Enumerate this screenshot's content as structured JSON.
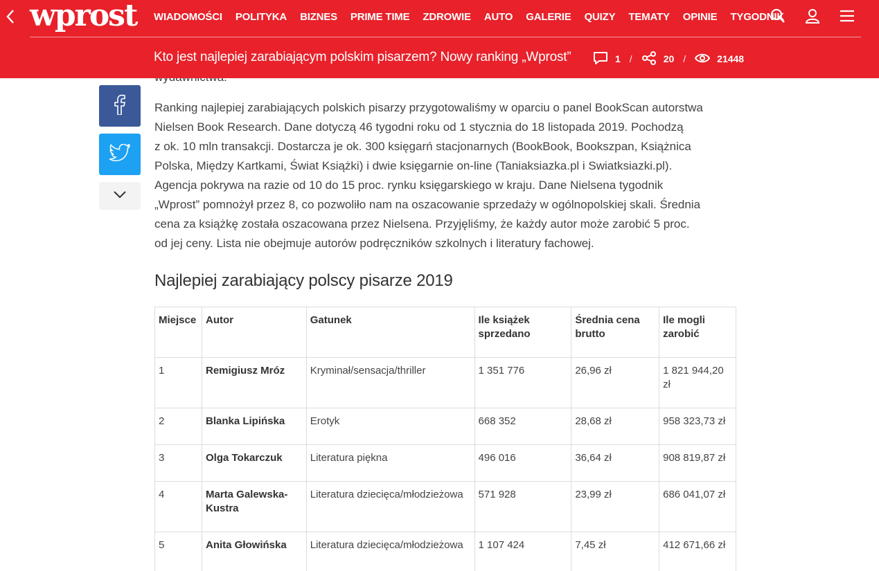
{
  "header": {
    "logo": "wprost",
    "nav": [
      "WIADOMOŚCI",
      "POLITYKA",
      "BIZNES",
      "PRIME TIME",
      "ZDROWIE",
      "AUTO",
      "GALERIE",
      "QUIZY",
      "TEMATY",
      "OPINIE",
      "TYGODNIK"
    ],
    "article_title": "Kto jest najlepiej zarabiającym polskim pisarzem? Nowy ranking „Wprost”",
    "comments": "1",
    "shares": "20",
    "views": "21448",
    "separator": "/"
  },
  "article": {
    "cut_text": "wydawnictwa.",
    "paragraph_lines": [
      "Ranking najlepiej zarabiających polskich pisarzy przygotowaliśmy w oparciu o panel BookScan autorstwa",
      "Nielsen Book Research. Dane dotyczą 46 tygodni roku od 1 stycznia do 18 listopada 2019. Pochodzą",
      "z ok. 10 mln transakcji. Dostarcza je ok. 300 księgarń stacjonarnych (BookBook, Bookszpan, Książnica",
      "Polska, Między Kartkami, Świat Książki) i dwie księgarnie on-line (Taniaksiazka.pl i Swiatksiazki.pl).",
      "Agencja pokrywa na razie od 10 do 15 proc. rynku księgarskiego w kraju. Dane Nielsena tygodnik",
      "„Wprost” pomnożył przez 8, co pozwoliło nam na oszacowanie sprzedaży w ogólnopolskiej skali. Średnia",
      "cena za książkę została oszacowana przez Nielsena. Przyjęliśmy, że każdy autor może zarobić 5 proc.",
      "od jej ceny. Lista nie obejmuje autorów podręczników szkolnych i literatury fachowej."
    ],
    "section_title": "Najlepiej zarabiający polscy pisarze 2019"
  },
  "table": {
    "headers": [
      "Miejsce",
      "Autor",
      "Gatunek",
      "Ile książek sprzedano",
      "Średnia cena brutto",
      "Ile mogli zarobić"
    ],
    "rows": [
      [
        "1",
        "Remigiusz Mróz",
        "Kryminał/sensacja/thriller",
        "1 351 776",
        "26,96 zł",
        "1 821 944,20 zł"
      ],
      [
        "2",
        "Blanka Lipińska",
        "Erotyk",
        "668 352",
        "28,68 zł",
        "958 323,73 zł"
      ],
      [
        "3",
        "Olga Tokarczuk",
        "Literatura piękna",
        "496 016",
        "36,64 zł",
        "908 819,87 zł"
      ],
      [
        "4",
        "Marta Galewska-Kustra",
        "Literatura dziecięca/młodzieżowa",
        "571 928",
        "23,99 zł",
        "686 041,07 zł"
      ],
      [
        "5",
        "Anita Głowińska",
        "Literatura dziecięca/młodzieżowa",
        "1 107 424",
        "7,45 zł",
        "412 671,66 zł"
      ]
    ]
  },
  "icons": {
    "back": "chevron-left-icon",
    "search": "search-icon",
    "user": "user-icon",
    "menu": "hamburger-menu-icon",
    "comment": "comment-icon",
    "share": "share-icon",
    "views": "eye-icon",
    "facebook": "facebook-icon",
    "twitter": "twitter-icon",
    "expand": "chevron-down-icon"
  },
  "colors": {
    "brand_red": "#e8212a",
    "facebook": "#3b5998",
    "twitter": "#1da1f2"
  }
}
